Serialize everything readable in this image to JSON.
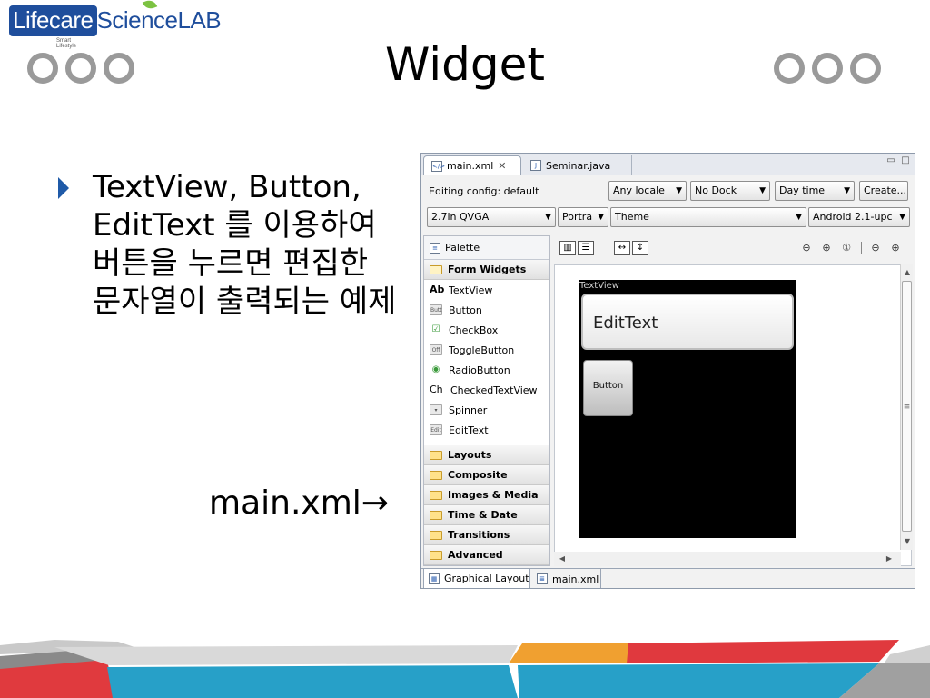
{
  "logo": {
    "part1": "Lifecare",
    "part2": "ScienceLAB",
    "sub": "Smart Lifestyle"
  },
  "slide": {
    "title": "Widget",
    "bullet": "TextView, Button, EditText 를 이용하여 버튼을 누르면 편집한 문자열이 출력되는 예제",
    "caption": "main.xml→"
  },
  "editor": {
    "tabs": [
      {
        "label": "main.xml",
        "icon": "xml-file-icon"
      },
      {
        "label": "Seminar.java",
        "icon": "java-file-icon"
      }
    ],
    "config": {
      "label": "Editing config: default",
      "locale": "Any locale",
      "dock": "No Dock",
      "time": "Day time",
      "create": "Create...",
      "screen": "2.7in QVGA",
      "orientation": "Portra",
      "theme": "Theme",
      "target": "Android 2.1-upc"
    },
    "palette": {
      "title": "Palette",
      "open_category": "Form Widgets",
      "items": [
        {
          "label": "TextView",
          "icon": "Ab"
        },
        {
          "label": "Button",
          "icon": "Butt"
        },
        {
          "label": "CheckBox",
          "icon": "☑"
        },
        {
          "label": "ToggleButton",
          "icon": "Off"
        },
        {
          "label": "RadioButton",
          "icon": "◉"
        },
        {
          "label": "CheckedTextView",
          "icon": "Ch"
        },
        {
          "label": "Spinner",
          "icon": "▾"
        },
        {
          "label": "EditText",
          "icon": "Edit"
        }
      ],
      "categories": [
        "Layouts",
        "Composite",
        "Images & Media",
        "Time & Date",
        "Transitions",
        "Advanced"
      ]
    },
    "preview": {
      "textview": "TextView",
      "edittext": "EditText",
      "button": "Button"
    },
    "bottom_tabs": [
      "Graphical Layout",
      "main.xml"
    ]
  }
}
